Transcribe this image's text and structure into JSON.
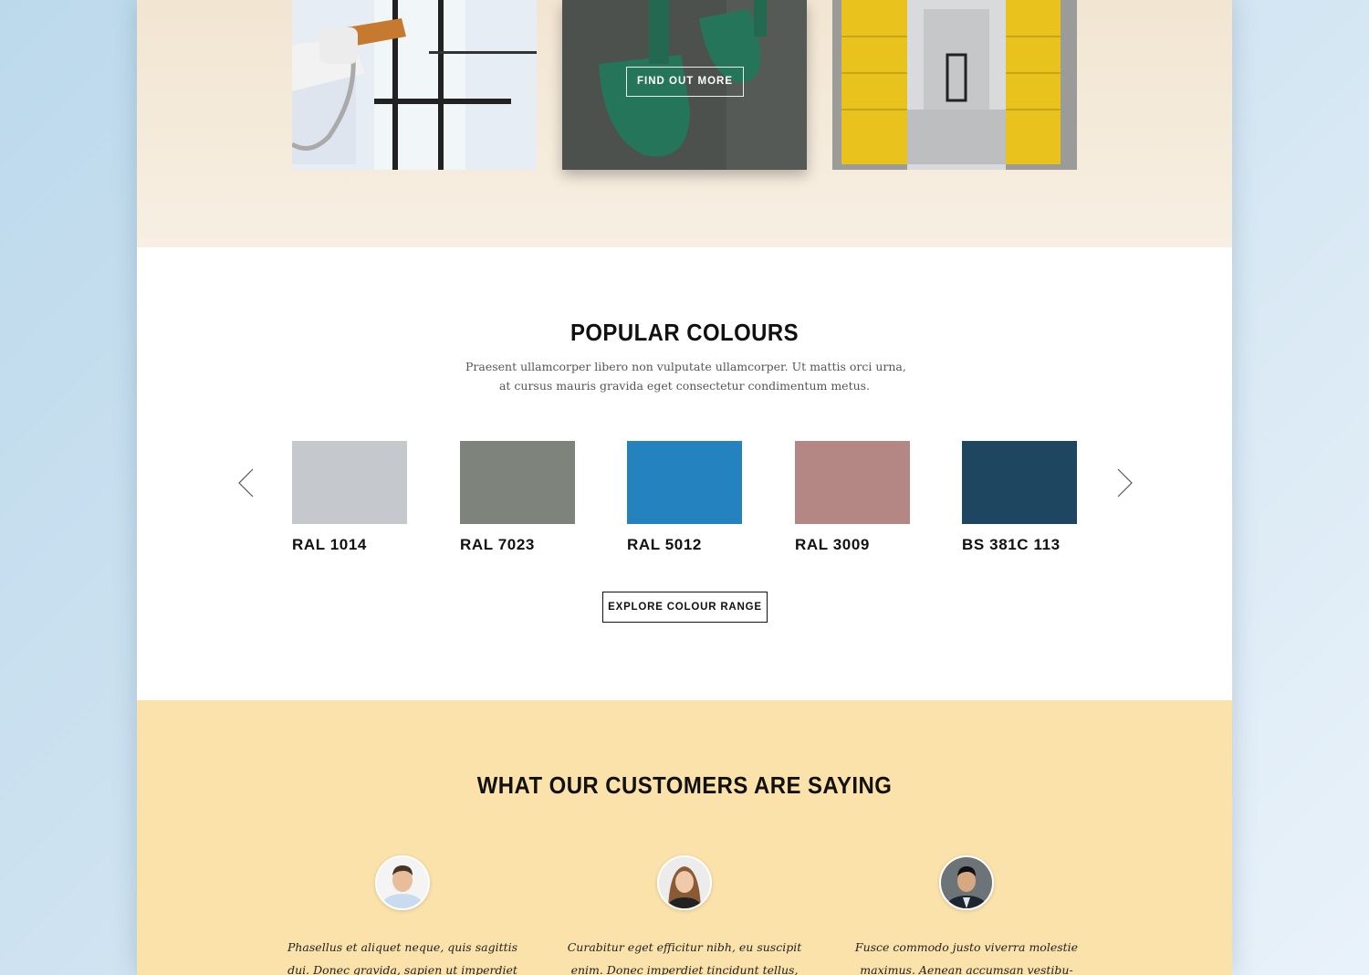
{
  "gallery": {
    "cta_label": "FIND OUT MORE"
  },
  "colours": {
    "title": "POPULAR COLOURS",
    "intro_line_1": "Praesent ullamcorper libero non vulputate ullamcorper. Ut mattis orci urna,",
    "intro_line_2": "at cursus mauris gravida eget consectetur condimentum metus.",
    "swatches": [
      {
        "label": "RAL 1014",
        "color": "#c5c8cc"
      },
      {
        "label": "RAL 7023",
        "color": "#7e847b"
      },
      {
        "label": "RAL 5012",
        "color": "#2482bf"
      },
      {
        "label": "RAL 3009",
        "color": "#b48784"
      },
      {
        "label": "BS 381C 113",
        "color": "#1e4661"
      }
    ],
    "explore_label": "EXPLORE COLOUR RANGE",
    "prev_icon": "chevron-left-icon",
    "next_icon": "chevron-right-icon"
  },
  "testimonials": {
    "title": "WHAT OUR CUSTOMERS ARE SAYING",
    "items": [
      {
        "line_1": "Phasellus et aliquet neque, quis sagittis",
        "line_2": "dui. Donec gravida, sapien ut imperdiet"
      },
      {
        "line_1": "Curabitur eget efficitur nibh, eu suscipit",
        "line_2": "enim. Donec imperdiet tincidunt tellus,"
      },
      {
        "line_1": "Fusce commodo justo viverra molestie",
        "line_2": "maximus. Aenean accumsan vestibu-"
      }
    ]
  }
}
